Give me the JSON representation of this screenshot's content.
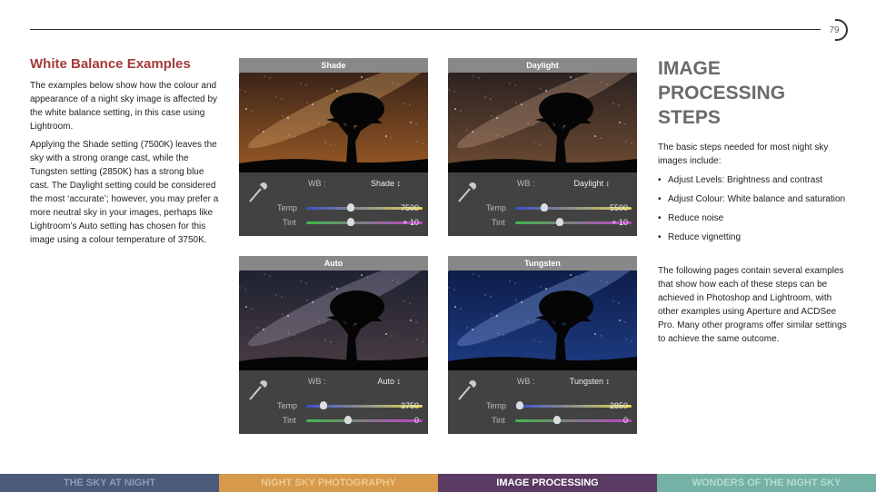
{
  "page_number": "79",
  "intro": {
    "title": "White Balance Examples",
    "paragraphs": [
      "The examples below show how the colour and appearance of a night sky image is affected by the white balance setting, in this case using Lightroom.",
      "Applying the Shade setting (7500K) leaves the sky with a strong orange cast, while the Tungsten setting (2850K) has a strong blue cast. The Daylight setting could be considered the most ‘accurate’; however, you may prefer a more neutral sky in your images, perhaps like Lightroom’s Auto setting has chosen for this image using a colour temperature of 3750K."
    ]
  },
  "panels": [
    {
      "title": "Shade",
      "wb_label": "WB :",
      "wb_value": "Shade ↕",
      "temp_label": "Temp",
      "tint_label": "Tint",
      "temp": "7500",
      "tint": "+ 10",
      "temp_fraction": 0.38,
      "tint_fraction": 0.38,
      "sky_top": "#3a2418",
      "sky_bottom": "#9a5a26",
      "band": "#e6b070"
    },
    {
      "title": "Daylight",
      "wb_label": "WB :",
      "wb_value": "Daylight ↕",
      "temp_label": "Temp",
      "tint_label": "Tint",
      "temp": "5500",
      "tint": "+ 10",
      "temp_fraction": 0.25,
      "tint_fraction": 0.38,
      "sky_top": "#2c2220",
      "sky_bottom": "#6e4c34",
      "band": "#c6a088"
    },
    {
      "title": "Auto",
      "wb_label": "WB :",
      "wb_value": "Auto ↕",
      "temp_label": "Temp",
      "tint_label": "Tint",
      "temp": "3750",
      "tint": "0",
      "temp_fraction": 0.15,
      "tint_fraction": 0.36,
      "sky_top": "#1e2232",
      "sky_bottom": "#4a3c42",
      "band": "#a8a0b8"
    },
    {
      "title": "Tungsten",
      "wb_label": "WB :",
      "wb_value": "Tungsten ↕",
      "temp_label": "Temp",
      "tint_label": "Tint",
      "temp": "2850",
      "tint": "0",
      "temp_fraction": 0.04,
      "tint_fraction": 0.36,
      "sky_top": "#0e1e4a",
      "sky_bottom": "#1e3c84",
      "band": "#8aa6e6"
    }
  ],
  "side": {
    "heading_lines": [
      "IMAGE",
      "PROCESSING",
      "STEPS"
    ],
    "intro": "The basic steps needed for most night sky images include:",
    "bullets": [
      "Adjust Levels: Brightness and contrast",
      "Adjust Colour: White balance and saturation",
      "Reduce noise",
      "Reduce vignetting"
    ],
    "outro": "The following pages contain several examples that show how each of these steps can be achieved in Photoshop and Lightroom, with other examples using Aperture and ACDSee Pro. Many other programs offer similar settings to achieve the same outcome."
  },
  "footer": [
    {
      "label": "THE SKY AT NIGHT",
      "bg": "#4b5a78",
      "fg": "#8f9bb8"
    },
    {
      "label": "NIGHT SKY PHOTOGRAPHY",
      "bg": "#d79a4d",
      "fg": "#f0c98c"
    },
    {
      "label": "IMAGE PROCESSING",
      "bg": "#5b3b63",
      "fg": "#ffffff"
    },
    {
      "label": "WONDERS OF THE NIGHT SKY",
      "bg": "#76b1a5",
      "fg": "#b3dcd3"
    }
  ]
}
